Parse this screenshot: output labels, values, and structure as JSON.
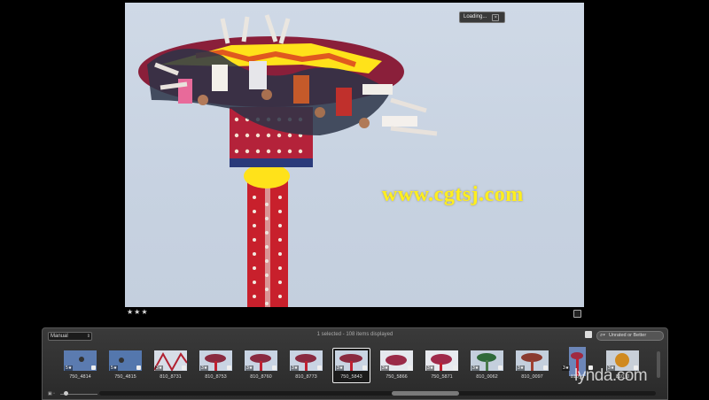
{
  "viewer": {
    "loading_label": "Loading...",
    "watermark": "www.cgtsj.com",
    "rating": "★★★"
  },
  "browser": {
    "sort_value": "Manual",
    "selection_status": "1 selected - 108 items displayed",
    "filter_value": "Unrated or Better",
    "thumbnails": [
      {
        "label": "750_4814",
        "rating": "5★"
      },
      {
        "label": "750_4815",
        "rating": "5★"
      },
      {
        "label": "810_8731",
        "rating": "3★"
      },
      {
        "label": "810_8753",
        "rating": "3★"
      },
      {
        "label": "810_8760",
        "rating": "3★"
      },
      {
        "label": "810_8773",
        "rating": "3★"
      },
      {
        "label": "750_5843",
        "rating": "3★"
      },
      {
        "label": "750_5866",
        "rating": "3★"
      },
      {
        "label": "750_5871",
        "rating": "3★"
      },
      {
        "label": "810_0062",
        "rating": "3★"
      },
      {
        "label": "810_0097",
        "rating": "3★"
      },
      {
        "label": "810_0",
        "rating": "3★"
      },
      {
        "label": "810_0",
        "rating": "3★"
      }
    ]
  },
  "branding": {
    "logo": "lynda.com"
  },
  "colors": {
    "sky": "#c8d3e2",
    "watermark": "#ffef1e",
    "panel": "#333333",
    "selection_border": "#eeeeee"
  }
}
